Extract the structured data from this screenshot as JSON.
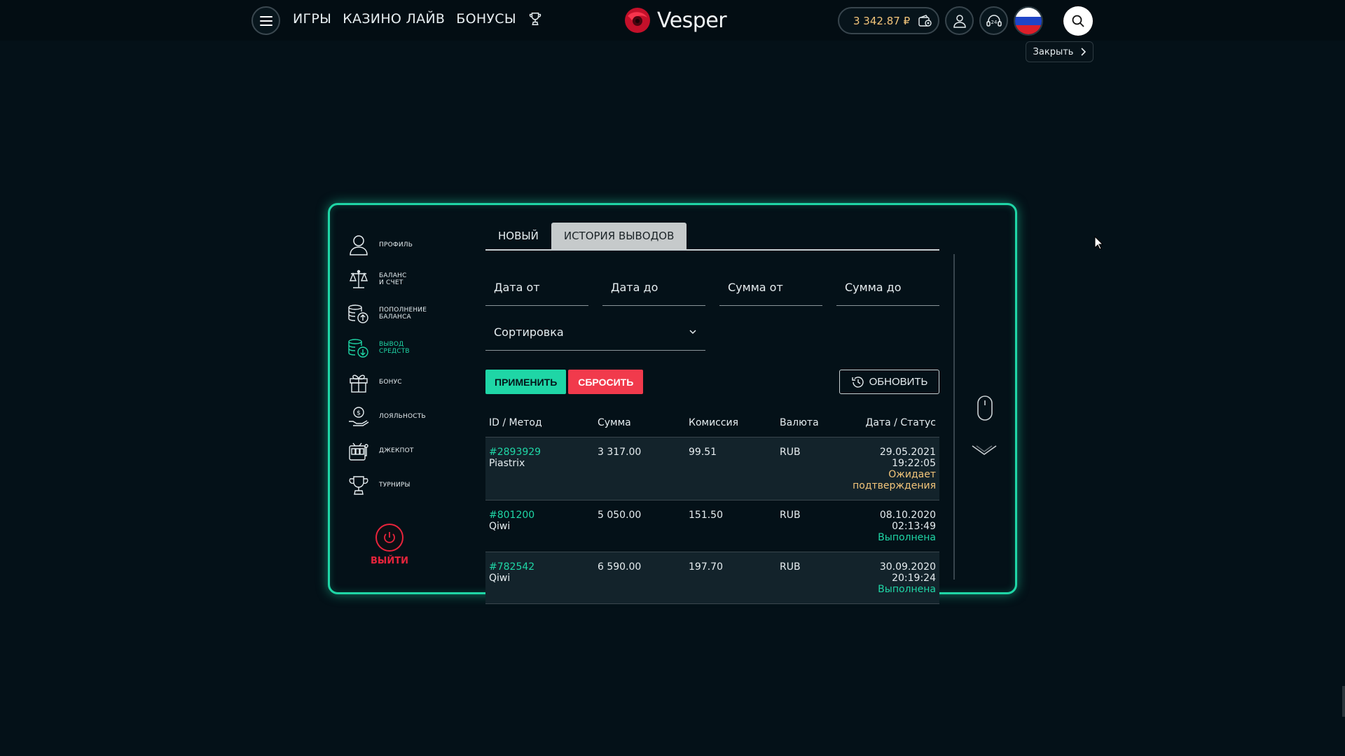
{
  "header": {
    "nav": [
      "ИГРЫ",
      "КАЗИНО ЛАЙВ",
      "БОНУСЫ"
    ],
    "logo_text": "Vesper",
    "balance": "3 342.87 ₽",
    "close_label": "Закрыть"
  },
  "sidebar": {
    "items": [
      {
        "label": "ПРОФИЛЬ",
        "icon": "user-icon"
      },
      {
        "label": "БАЛАНС\nИ СЧЕТ",
        "icon": "scales-icon"
      },
      {
        "label": "ПОПОЛНЕНИЕ\nБАЛАНСА",
        "icon": "coins-up-icon"
      },
      {
        "label": "ВЫВОД\nСРЕДСТВ",
        "icon": "coins-down-icon"
      },
      {
        "label": "БОНУС",
        "icon": "gift-icon"
      },
      {
        "label": "ЛОЯЛЬНОСТЬ",
        "icon": "hand-coin-icon"
      },
      {
        "label": "ДЖЕКПОТ",
        "icon": "slot-machine-icon"
      },
      {
        "label": "ТУРНИРЫ",
        "icon": "trophy-icon"
      }
    ],
    "logout_label": "ВЫЙТИ"
  },
  "tabs": [
    "НОВЫЙ",
    "ИСТОРИЯ ВЫВОДОВ"
  ],
  "filters": {
    "date_from": "Дата от",
    "date_to": "Дата до",
    "sum_from": "Сумма от",
    "sum_to": "Сумма до",
    "sort": "Сортировка"
  },
  "buttons": {
    "apply": "ПРИМЕНИТЬ",
    "reset": "СБРОСИТЬ",
    "refresh": "ОБНОВИТЬ"
  },
  "table": {
    "headers": [
      "ID / Метод",
      "Сумма",
      "Комиссия",
      "Валюта",
      "Дата / Статус"
    ],
    "rows": [
      {
        "id": "#2893929",
        "method": "Piastrix",
        "amount": "3 317.00",
        "fee": "99.51",
        "currency": "RUB",
        "date": "29.05.2021 19:22:05",
        "status": "Ожидает подтверждения"
      },
      {
        "id": "#801200",
        "method": "Qiwi",
        "amount": "5 050.00",
        "fee": "151.50",
        "currency": "RUB",
        "date": "08.10.2020 02:13:49",
        "status": "Выполнена"
      },
      {
        "id": "#782542",
        "method": "Qiwi",
        "amount": "6 590.00",
        "fee": "197.70",
        "currency": "RUB",
        "date": "30.09.2020 20:19:24",
        "status": "Выполнена"
      }
    ]
  },
  "colors": {
    "accent": "#1fd6a6",
    "danger": "#f13a4c",
    "pending": "#f3c57a",
    "background": "#041118"
  }
}
